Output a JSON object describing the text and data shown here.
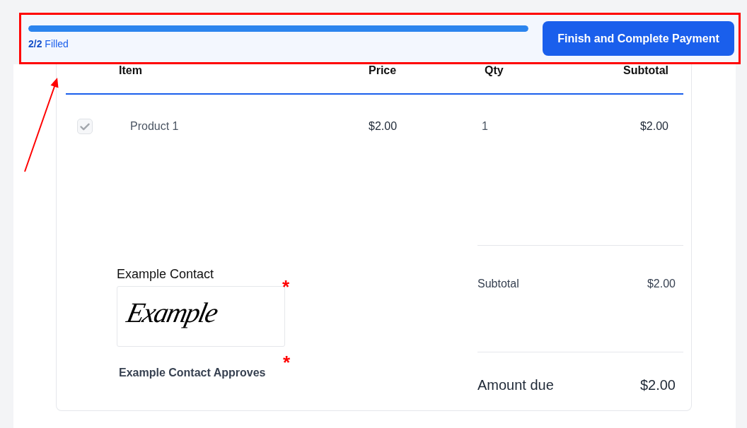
{
  "annotations": {
    "frame": true,
    "arrow": true
  },
  "progress": {
    "level": 1,
    "label": "**2/2** Filled"
  },
  "finish_button": {
    "label": "Finish and Complete Payment"
  },
  "table": {
    "columns": [
      "Item",
      "Price",
      "Qty",
      "Subtotal"
    ],
    "rows": [
      {
        "checked": true,
        "disabled": true,
        "item": "Product 1",
        "price": "$2.00",
        "qty": "1",
        "subtotal": "$2.00"
      }
    ]
  },
  "signature": {
    "signer": "Example Contact",
    "value": "Example",
    "required_mark": "*"
  },
  "approval": {
    "label": "Example Contact Approves",
    "required_mark": "*"
  },
  "summary": [
    {
      "kind": "subtotal",
      "label": "Subtotal",
      "value": "$2.00"
    },
    {
      "kind": "total",
      "label": "Amount due",
      "value": "$2.00"
    }
  ]
}
